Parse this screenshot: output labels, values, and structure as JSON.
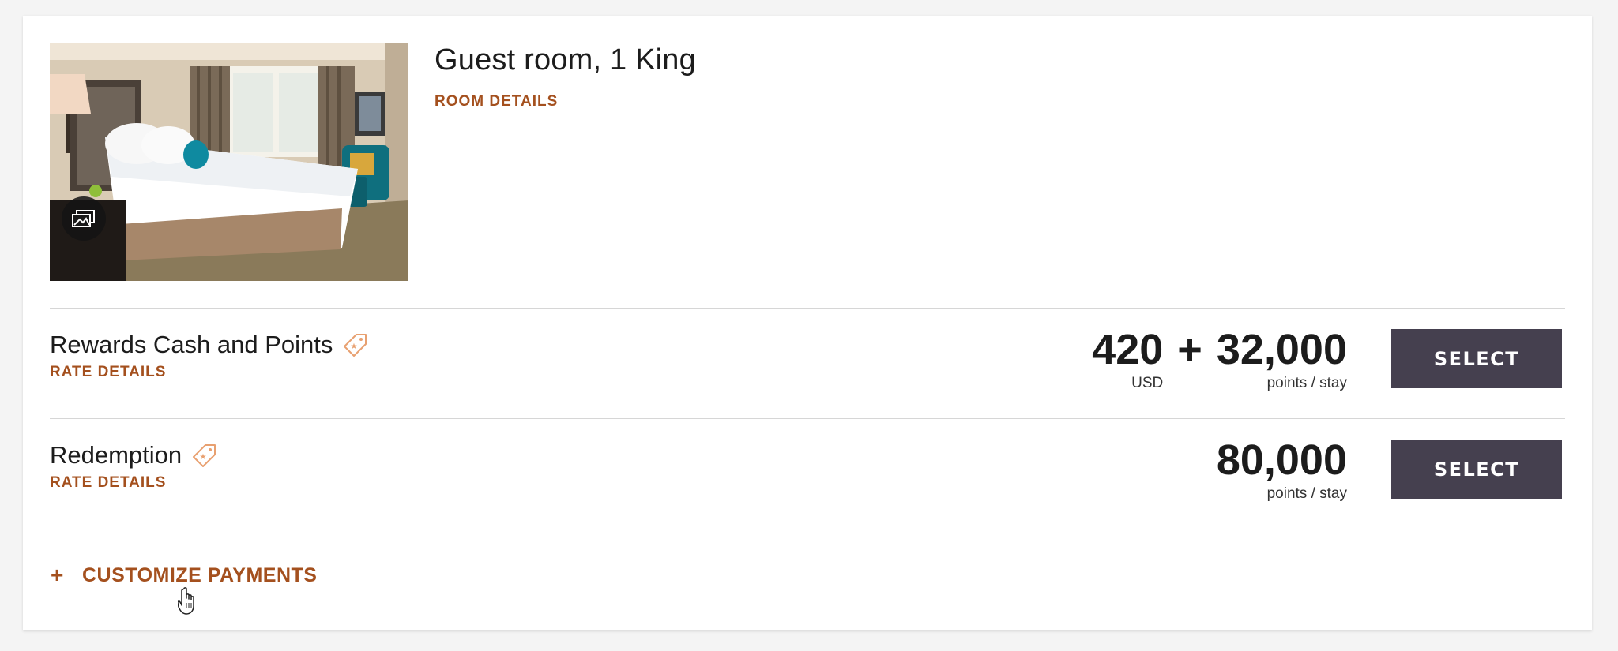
{
  "room": {
    "title": "Guest room, 1 King",
    "details_link": "ROOM DETAILS",
    "photo_icon": "gallery-icon"
  },
  "rates": [
    {
      "name": "Rewards Cash and Points",
      "details_link": "RATE DETAILS",
      "tag_icon": "price-tag-icon",
      "cash_amount": "420",
      "cash_unit": "USD",
      "separator": "+",
      "points_amount": "32,000",
      "points_unit": "points / stay",
      "select_label": "SELECT"
    },
    {
      "name": "Redemption",
      "details_link": "RATE DETAILS",
      "tag_icon": "price-tag-icon",
      "points_amount": "80,000",
      "points_unit": "points / stay",
      "select_label": "SELECT"
    }
  ],
  "customize": {
    "icon": "+",
    "label": "CUSTOMIZE PAYMENTS"
  },
  "colors": {
    "accent": "#a4501e",
    "button": "#45404f",
    "text": "#1c1c1c",
    "divider": "#d6d6d6",
    "background": "#f4f4f4"
  }
}
